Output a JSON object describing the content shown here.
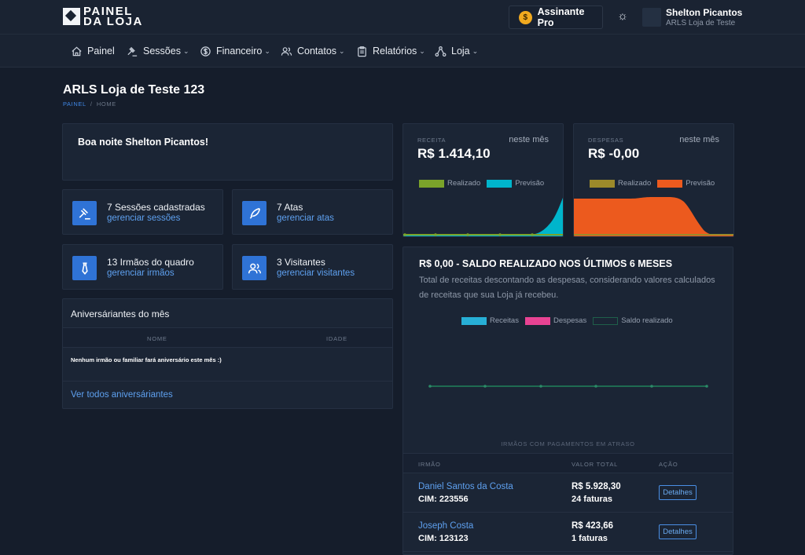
{
  "brand": {
    "line1": "PAINEL",
    "line2": "DA LOJA"
  },
  "header": {
    "pro_label": "Assinante Pro",
    "user_name": "Shelton Picantos",
    "user_lodge": "ARLS Loja de Teste"
  },
  "nav": [
    {
      "label": "Painel",
      "icon": "home-icon"
    },
    {
      "label": "Sessões",
      "icon": "gavel-icon"
    },
    {
      "label": "Financeiro",
      "icon": "dollar-icon"
    },
    {
      "label": "Contatos",
      "icon": "users-icon"
    },
    {
      "label": "Relatórios",
      "icon": "clipboard-icon"
    },
    {
      "label": "Loja",
      "icon": "network-icon"
    }
  ],
  "page": {
    "title": "ARLS Loja de Teste 123",
    "crumb_root": "PAINEL",
    "crumb_sep": "/",
    "crumb_current": "HOME"
  },
  "greeting": "Boa noite Shelton Picantos!",
  "stats": [
    {
      "title": "7 Sessões cadastradas",
      "link": "gerenciar sessões",
      "icon": "gavel-icon"
    },
    {
      "title": "7 Atas",
      "link": "gerenciar atas",
      "icon": "quill-icon"
    },
    {
      "title": "13 Irmãos do quadro",
      "link": "gerenciar irmãos",
      "icon": "tie-icon"
    },
    {
      "title": "3 Visitantes",
      "link": "gerenciar visitantes",
      "icon": "visitors-icon"
    }
  ],
  "birthdays": {
    "title": "Aniversáriantes do mês",
    "col_name": "NOME",
    "col_age": "IDADE",
    "empty": "Nenhum irmão ou familiar fará aniversário este mês :)",
    "link": "Ver todos aniversáriantes"
  },
  "receita": {
    "label": "RECEITA",
    "period": "neste mês",
    "value": "R$ 1.414,10",
    "legend": [
      "Realizado",
      "Previsão"
    ],
    "colors": [
      "#7aa32a",
      "#00b5cc"
    ]
  },
  "despesas": {
    "label": "DESPESAS",
    "period": "neste mês",
    "value": "R$ -0,00",
    "legend": [
      "Realizado",
      "Previsão"
    ],
    "colors": [
      "#9c8a2a",
      "#ec5a1e"
    ]
  },
  "saldo": {
    "title": "R$ 0,00 - SALDO REALIZADO NOS ÚLTIMOS 6 MESES",
    "desc": "Total de receitas descontando as despesas, considerando valores calculados de receitas que sua Loja já recebeu.",
    "legend": [
      "Receitas",
      "Despesas",
      "Saldo realizado"
    ],
    "colors": [
      "#27afd6",
      "#e84393",
      "#1f5f4a"
    ]
  },
  "arrears": {
    "label": "IRMÃOS COM PAGAMENTOS EM ATRASO",
    "col_member": "IRMÃO",
    "col_total": "VALOR TOTAL",
    "col_action": "AÇÃO",
    "rows": [
      {
        "name": "Daniel Santos da Costa",
        "cim": "CIM: 223556",
        "total": "R$ 5.928,30",
        "invoices": "24 faturas",
        "action": "Detalhes"
      },
      {
        "name": "Joseph Costa",
        "cim": "CIM: 123123",
        "total": "R$ 423,66",
        "invoices": "1 faturas",
        "action": "Detalhes"
      }
    ]
  }
}
